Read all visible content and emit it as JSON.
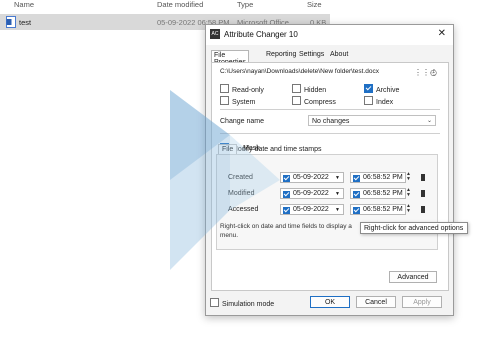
{
  "explorer": {
    "columns": {
      "name": "Name",
      "date_modified": "Date modified",
      "type": "Type",
      "size": "Size"
    },
    "file": {
      "name": "test",
      "date": "05-09-2022 06:58 PM",
      "type": "Microsoft Office...",
      "size": "0 KB"
    }
  },
  "dialog": {
    "title": "Attribute Changer 10",
    "app_icon_text": "AC",
    "close": "✕",
    "tabs": [
      "File Properties",
      "Reporting",
      "Settings",
      "About"
    ],
    "path": "C:\\Users\\nayan\\Downloads\\delete\\New folder\\test.docx",
    "attributes": [
      {
        "label": "Read-only",
        "checked": false
      },
      {
        "label": "Hidden",
        "checked": false
      },
      {
        "label": "Archive",
        "checked": true
      },
      {
        "label": "System",
        "checked": false
      },
      {
        "label": "Compress",
        "checked": false
      },
      {
        "label": "Index",
        "checked": false
      }
    ],
    "change_name_label": "Change name",
    "change_name_value": "No changes",
    "modify_dates_label": "Modify date and time stamps",
    "sub_tabs": [
      "File",
      "Mask"
    ],
    "date_rows": [
      {
        "label": "Created",
        "date": "05-09-2022",
        "time": "06:58:52  PM"
      },
      {
        "label": "Modified",
        "date": "05-09-2022",
        "time": "06:58:52  PM"
      },
      {
        "label": "Accessed",
        "date": "05-09-2022",
        "time": "06:58:52  PM"
      }
    ],
    "hint": "Right-click on date and time fields to display a",
    "hint_line2": "menu.",
    "advanced": "Advanced",
    "simulation_mode": "Simulation mode",
    "ok": "OK",
    "cancel": "Cancel",
    "apply": "Apply"
  },
  "tooltip": "Right-click for advanced options",
  "colors": {
    "accent": "#1f6fc4",
    "overlay": "#9fc3e0"
  }
}
